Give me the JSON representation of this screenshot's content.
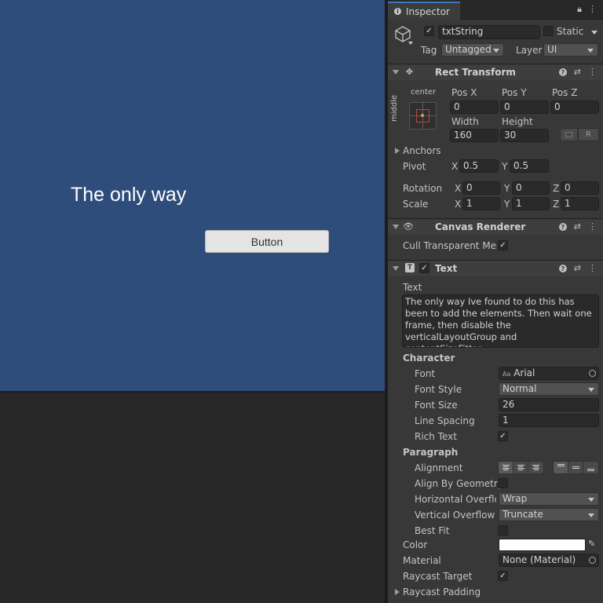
{
  "game": {
    "text": "The only way",
    "button_label": "Button"
  },
  "inspector": {
    "tab_title": "Inspector",
    "object_name": "txtString",
    "static_label": "Static",
    "tag_label": "Tag",
    "tag_value": "Untagged",
    "layer_label": "Layer",
    "layer_value": "UI"
  },
  "rect_transform": {
    "title": "Rect Transform",
    "anchor_h": "center",
    "anchor_v": "middle",
    "pos_x_label": "Pos X",
    "pos_y_label": "Pos Y",
    "pos_z_label": "Pos Z",
    "pos_x": "0",
    "pos_y": "0",
    "pos_z": "0",
    "width_label": "Width",
    "height_label": "Height",
    "width": "160",
    "height": "30",
    "r_button": "R",
    "anchors_label": "Anchors",
    "pivot_label": "Pivot",
    "pivot_x_label": "X",
    "pivot_x": "0.5",
    "pivot_y_label": "Y",
    "pivot_y": "0.5",
    "rotation_label": "Rotation",
    "rot_x": "0",
    "rot_y": "0",
    "rot_z": "0",
    "scale_label": "Scale",
    "scale_x": "1",
    "scale_y": "1",
    "scale_z": "1",
    "x": "X",
    "y": "Y",
    "z": "Z"
  },
  "canvas_renderer": {
    "title": "Canvas Renderer",
    "cull_label": "Cull Transparent Mes"
  },
  "text_component": {
    "title": "Text",
    "text_label": "Text",
    "text_value": "The only way Ive found to do this has been to add the elements. Then wait one frame, then disable the verticalLayoutGroup and contentSizeFitter.",
    "character_label": "Character",
    "font_label": "Font",
    "font_value": "Arial",
    "font_prefix": "Aa",
    "font_style_label": "Font Style",
    "font_style_value": "Normal",
    "font_size_label": "Font Size",
    "font_size_value": "26",
    "line_spacing_label": "Line Spacing",
    "line_spacing_value": "1",
    "rich_text_label": "Rich Text",
    "paragraph_label": "Paragraph",
    "alignment_label": "Alignment",
    "align_by_geometry_label": "Align By Geometry",
    "h_overflow_label": "Horizontal Overflo",
    "h_overflow_value": "Wrap",
    "v_overflow_label": "Vertical Overflow",
    "v_overflow_value": "Truncate",
    "best_fit_label": "Best Fit",
    "color_label": "Color",
    "color_value": "#ffffff",
    "material_label": "Material",
    "material_value": "None (Material)",
    "raycast_target_label": "Raycast Target",
    "raycast_padding_label": "Raycast Padding"
  }
}
